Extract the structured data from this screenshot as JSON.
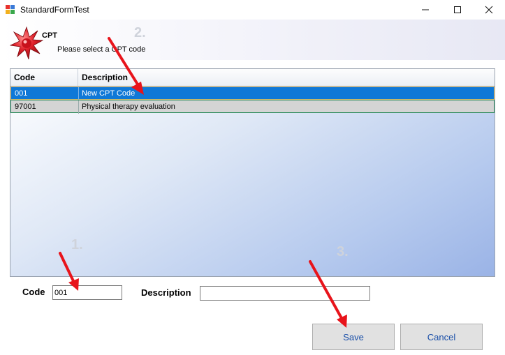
{
  "window": {
    "title": "StandardFormTest",
    "minimize_icon": "minimize-icon",
    "maximize_icon": "maximize-icon",
    "close_icon": "close-icon"
  },
  "header": {
    "title": "CPT",
    "subtitle": "Please select a CPT code",
    "icon": "red-star-icon"
  },
  "grid": {
    "columns": [
      "Code",
      "Description"
    ],
    "rows": [
      {
        "code": "001",
        "description": "New CPT Code",
        "selected": true
      },
      {
        "code": "97001",
        "description": "Physical therapy evaluation",
        "selected": false
      }
    ]
  },
  "form": {
    "code_label": "Code",
    "code_value": "001",
    "description_label": "Description",
    "description_value": ""
  },
  "buttons": {
    "save": "Save",
    "cancel": "Cancel"
  },
  "annotations": {
    "step1": "1.",
    "step2": "2.",
    "step3": "3.",
    "arrow_color": "#e8141b"
  },
  "colors": {
    "selection": "#0f78d7",
    "button_text": "#1a4fa8"
  }
}
